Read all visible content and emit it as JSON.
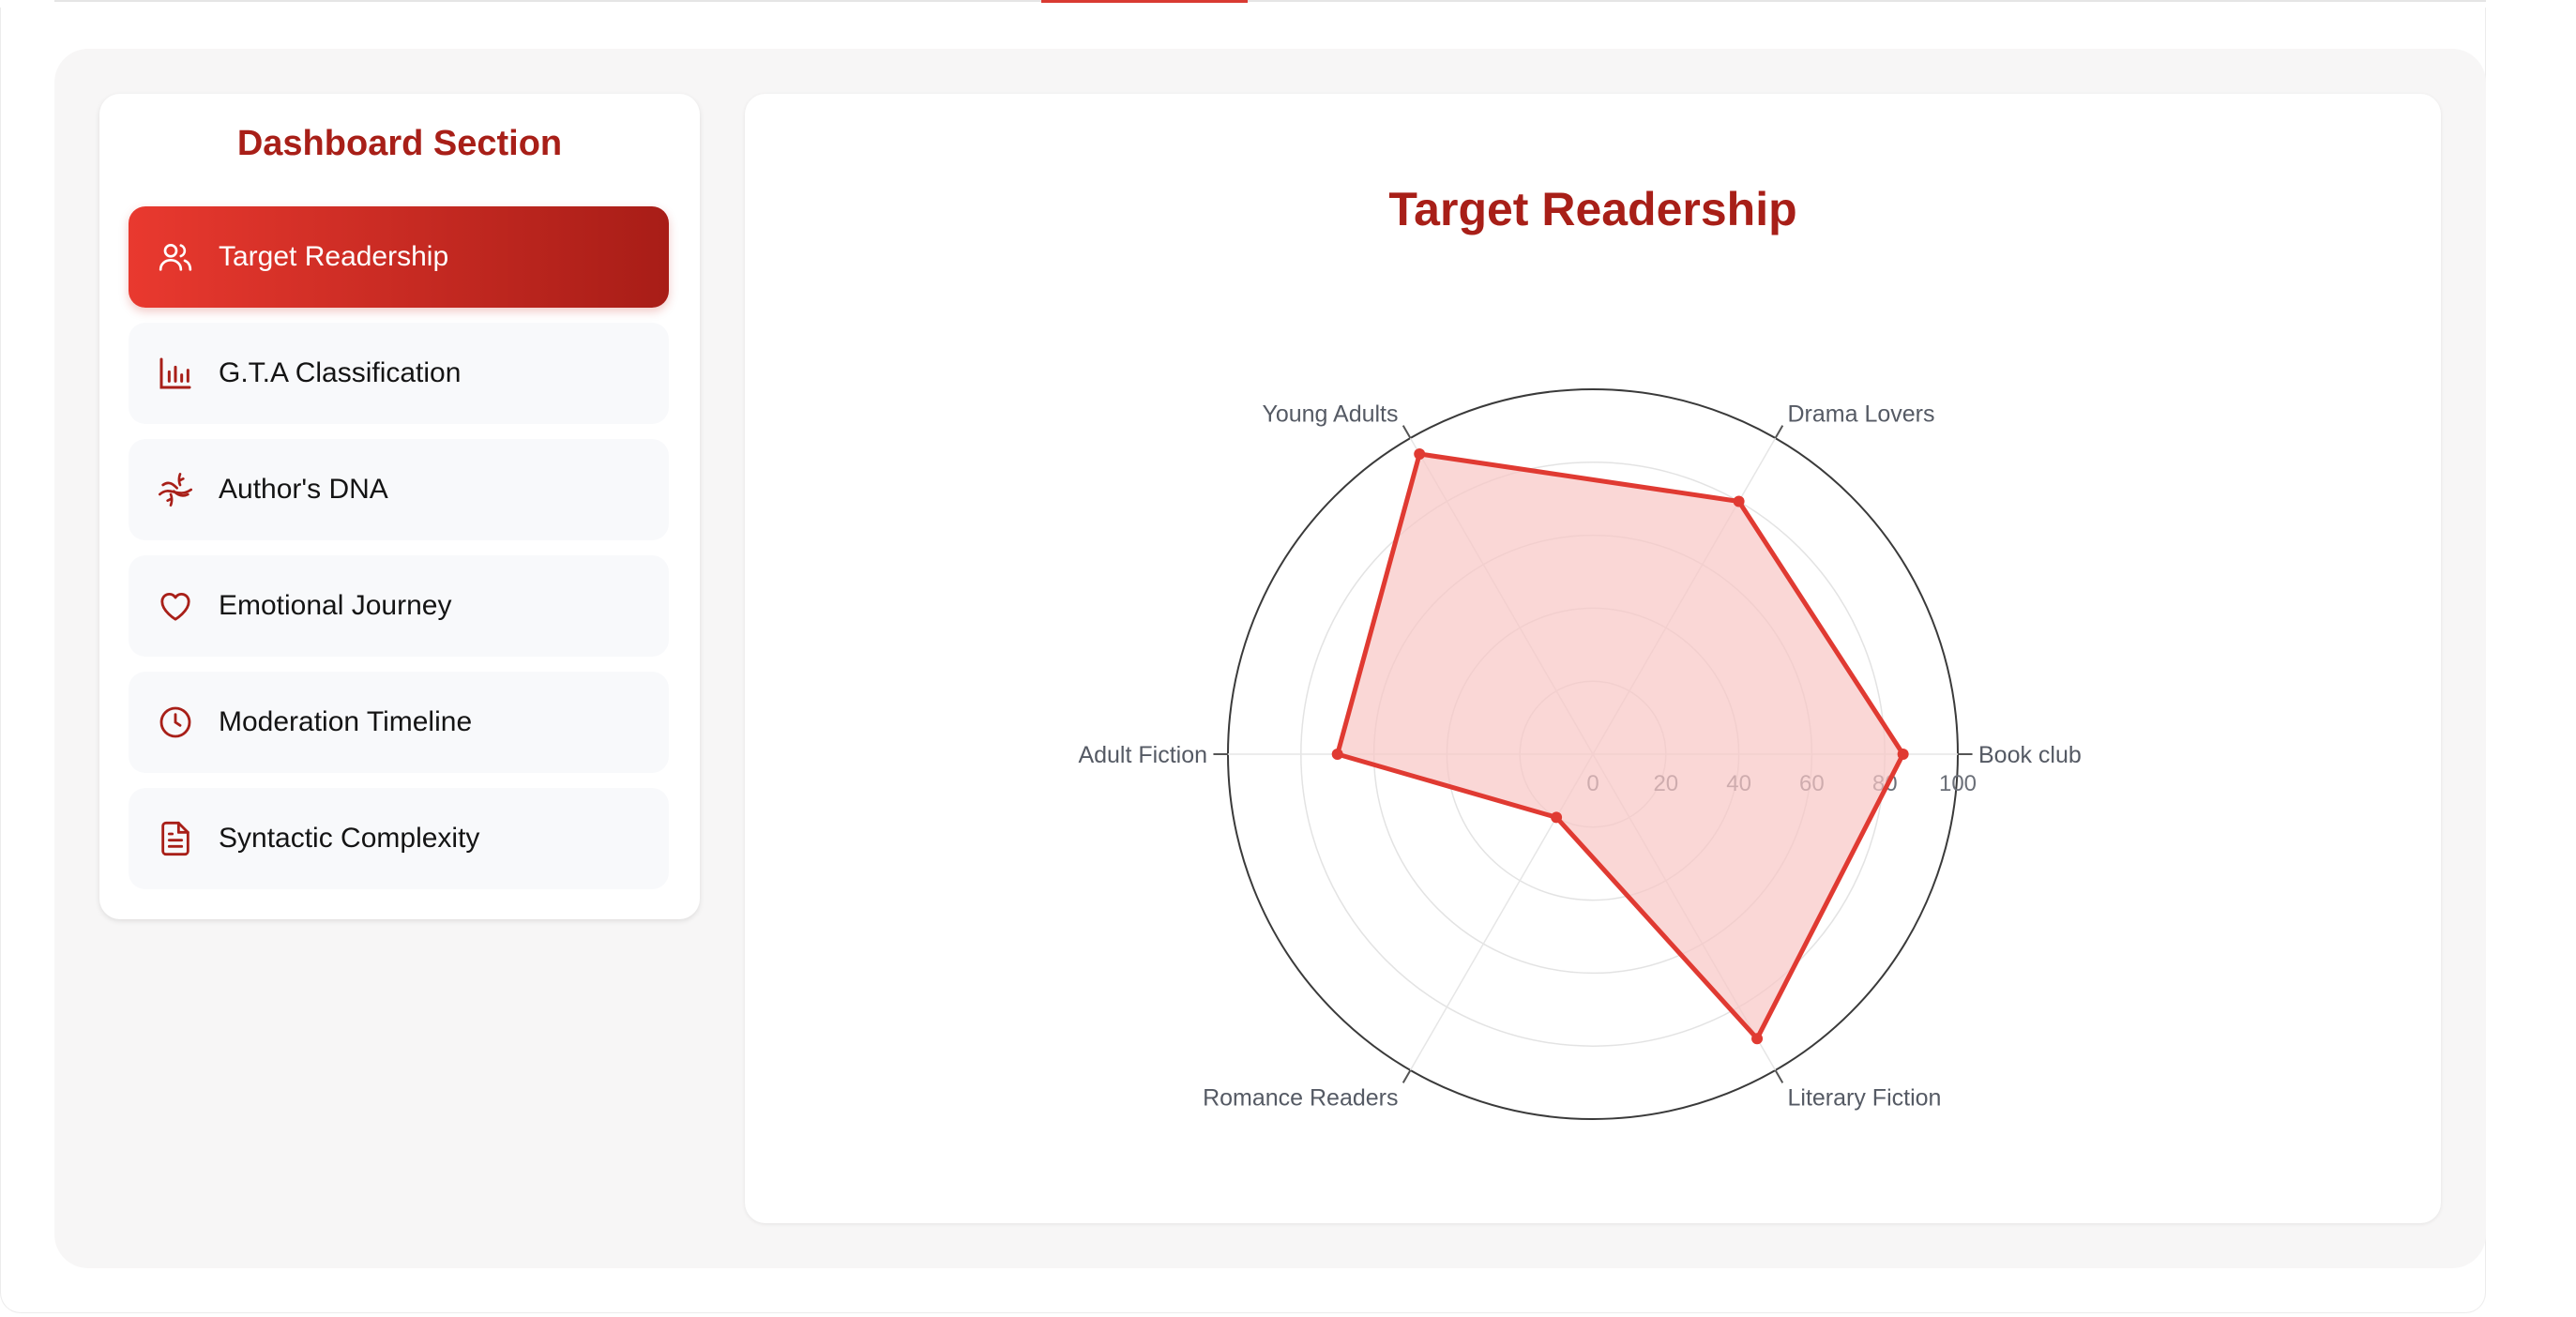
{
  "sidebar": {
    "title": "Dashboard Section",
    "items": [
      {
        "label": "Target Readership",
        "icon": "users-icon",
        "active": true
      },
      {
        "label": "G.T.A Classification",
        "icon": "bar-chart-icon",
        "active": false
      },
      {
        "label": "Author's DNA",
        "icon": "dna-icon",
        "active": false
      },
      {
        "label": "Emotional Journey",
        "icon": "heart-icon",
        "active": false
      },
      {
        "label": "Moderation Timeline",
        "icon": "clock-icon",
        "active": false
      },
      {
        "label": "Syntactic Complexity",
        "icon": "document-icon",
        "active": false
      }
    ]
  },
  "colors": {
    "accent": "#a81f18",
    "accent_light": "#e9392f",
    "series_stroke": "#e03a32",
    "series_fill": "#f8c6c4"
  },
  "chart_data": {
    "type": "radar",
    "title": "Target Readership",
    "categories": [
      "Book club",
      "Drama Lovers",
      "Young Adults",
      "Adult Fiction",
      "Romance Readers",
      "Literary Fiction"
    ],
    "values": [
      85,
      80,
      95,
      70,
      20,
      90
    ],
    "r_ticks": [
      0,
      20,
      40,
      60,
      80,
      100
    ],
    "rlim": [
      0,
      100
    ],
    "grid": true,
    "legend": "none"
  }
}
